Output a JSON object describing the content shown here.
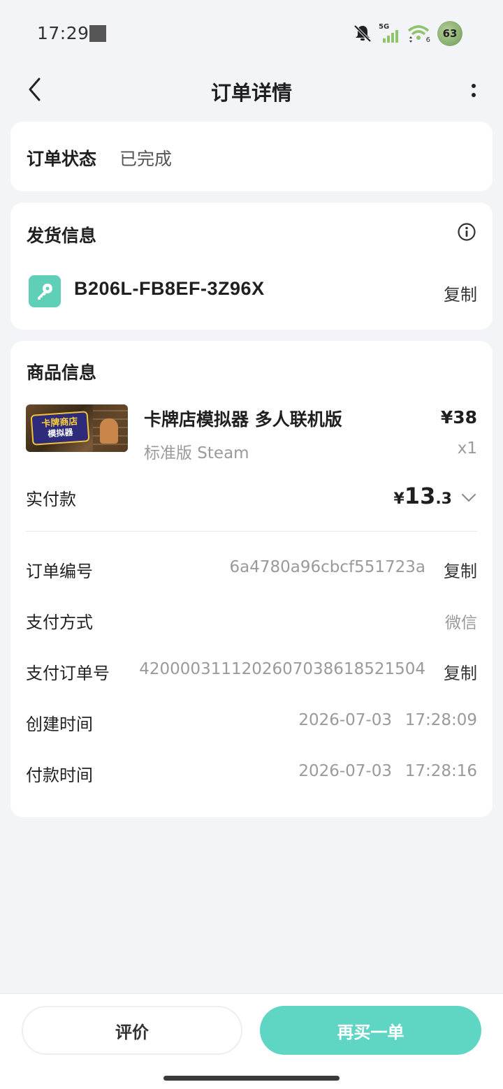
{
  "status_bar": {
    "time": "17:29",
    "network": "5G",
    "wifi_badge": "6",
    "battery": "63",
    "icons": [
      "notifications-muted-icon",
      "signal-icon",
      "wifi-icon",
      "battery-icon"
    ]
  },
  "header": {
    "title": "订单详情",
    "icons": [
      "back-arrow-icon",
      "more-vertical-icon"
    ]
  },
  "order_status": {
    "label": "订单状态",
    "value": "已完成"
  },
  "delivery": {
    "title": "发货信息",
    "key_code": "B206L-FB8EF-3Z96X",
    "copy_label": "复制",
    "icons": [
      "info-icon",
      "key-icon"
    ],
    "accent_color": "#5fcfb8"
  },
  "product": {
    "section_title": "商品信息",
    "thumb_text_line1": "卡牌商店",
    "thumb_text_line2": "模拟器",
    "name": "卡牌店模拟器 多人联机版",
    "price": "¥38",
    "edition": "标准版 Steam",
    "quantity": "x1",
    "paid_label": "实付款",
    "paid_currency": "¥",
    "paid_integer": "13",
    "paid_decimal": ".3"
  },
  "details": {
    "order_no_label": "订单编号",
    "order_no_value": "6a4780a96cbcf551723a",
    "order_no_copy": "复制",
    "pay_method_label": "支付方式",
    "pay_method_value": "微信",
    "pay_order_label": "支付订单号",
    "pay_order_value": "4200003111202607038618521504",
    "pay_order_copy": "复制",
    "created_label": "创建时间",
    "created_date": "2026-07-03",
    "created_time": "17:28:09",
    "paid_time_label": "付款时间",
    "paid_date": "2026-07-03",
    "paid_time": "17:28:16"
  },
  "bottom": {
    "review_label": "评价",
    "rebuy_label": "再买一单",
    "primary_color": "#5fd6c4"
  }
}
